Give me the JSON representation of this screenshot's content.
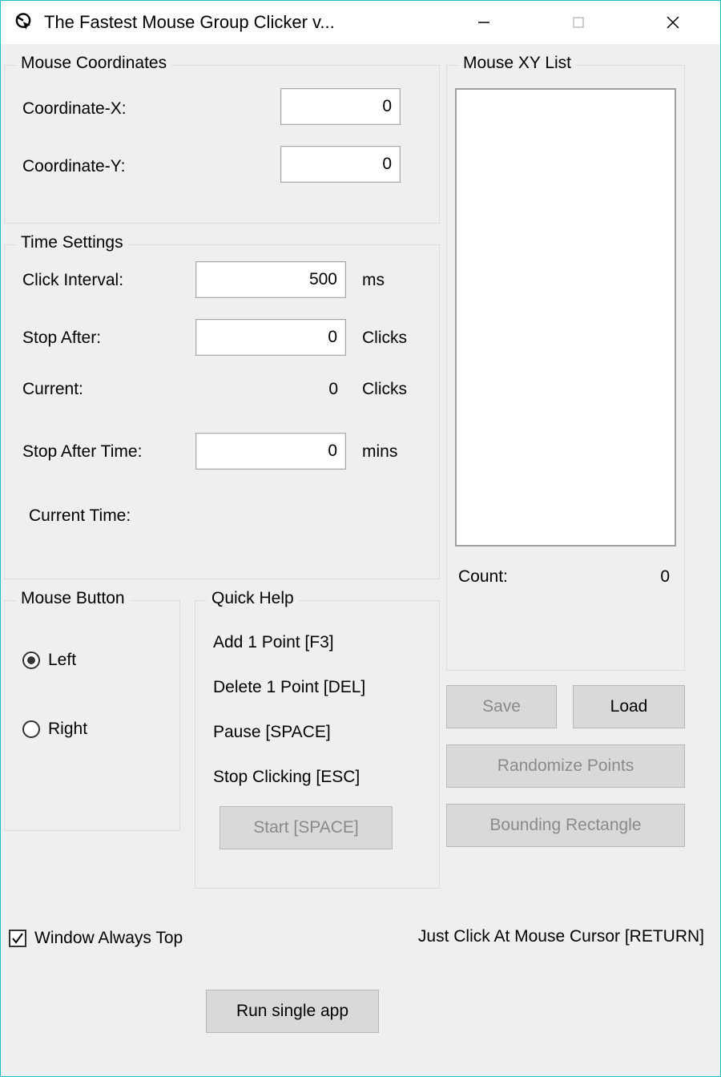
{
  "titlebar": {
    "title": "The Fastest Mouse Group Clicker v..."
  },
  "coordinates": {
    "legend": "Mouse Coordinates",
    "x_label": "Coordinate-X:",
    "x_value": "0",
    "y_label": "Coordinate-Y:",
    "y_value": "0"
  },
  "time": {
    "legend": "Time Settings",
    "interval_label": "Click Interval:",
    "interval_value": "500",
    "interval_unit": "ms",
    "stop_after_label": "Stop After:",
    "stop_after_value": "0",
    "stop_after_unit": "Clicks",
    "current_label": "Current:",
    "current_value": "0",
    "current_unit": "Clicks",
    "stop_after_time_label": "Stop After Time:",
    "stop_after_time_value": "0",
    "stop_after_time_unit": "mins",
    "current_time_label": "Current Time:",
    "current_time_value": ""
  },
  "mouse_button": {
    "legend": "Mouse Button",
    "left": "Left",
    "right": "Right"
  },
  "quick_help": {
    "legend": "Quick Help",
    "add": "Add 1 Point [F3]",
    "del": "Delete 1 Point [DEL]",
    "pause": "Pause [SPACE]",
    "stop": "Stop Clicking [ESC]",
    "start_btn": "Start [SPACE]"
  },
  "xy_list": {
    "legend": "Mouse XY List",
    "count_label": "Count:",
    "count_value": "0",
    "save_btn": "Save",
    "load_btn": "Load",
    "randomize_btn": "Randomize Points",
    "bounding_btn": "Bounding Rectangle"
  },
  "bottom": {
    "always_top": "Window Always Top",
    "just_click": "Just Click At Mouse Cursor [RETURN]",
    "run_single": "Run single app"
  }
}
